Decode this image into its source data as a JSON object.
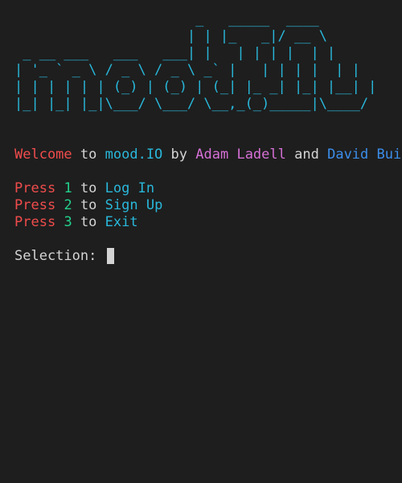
{
  "banner": {
    "ascii_art": "                      _   _____  ____  \n                     | | |_   _|/ __ \\ \n _ __ ___   ___   ___| |   | | | |  | |\n| '_ ` _ \\ / _ \\ / _ \\ _` |   | | | |  | |\n| | | | | | (_) | (_) | (_| |_ _| |_| |__| |\n|_| |_| |_|\\___/ \\___/ \\__,_(_)_____|\\____/"
  },
  "welcome": {
    "word_welcome": "Welcome",
    "word_to": "to",
    "app_name": "mood.IO",
    "word_by": "by",
    "author_1": "Adam Ladell",
    "word_and": "and",
    "author_2": "David Bui"
  },
  "menu": [
    {
      "press": "Press",
      "key": "1",
      "to": "to",
      "action": "Log In"
    },
    {
      "press": "Press",
      "key": "2",
      "to": "to",
      "action": "Sign Up"
    },
    {
      "press": "Press",
      "key": "3",
      "to": "to",
      "action": "Exit"
    }
  ],
  "prompt": {
    "label": "Selection:",
    "value": ""
  },
  "colors": {
    "background": "#1e1e1e",
    "foreground": "#d4d4d4",
    "red": "#f14c4c",
    "cyan": "#29b8db",
    "magenta": "#d670d6",
    "blue": "#3b8eea",
    "green": "#23d18b"
  }
}
